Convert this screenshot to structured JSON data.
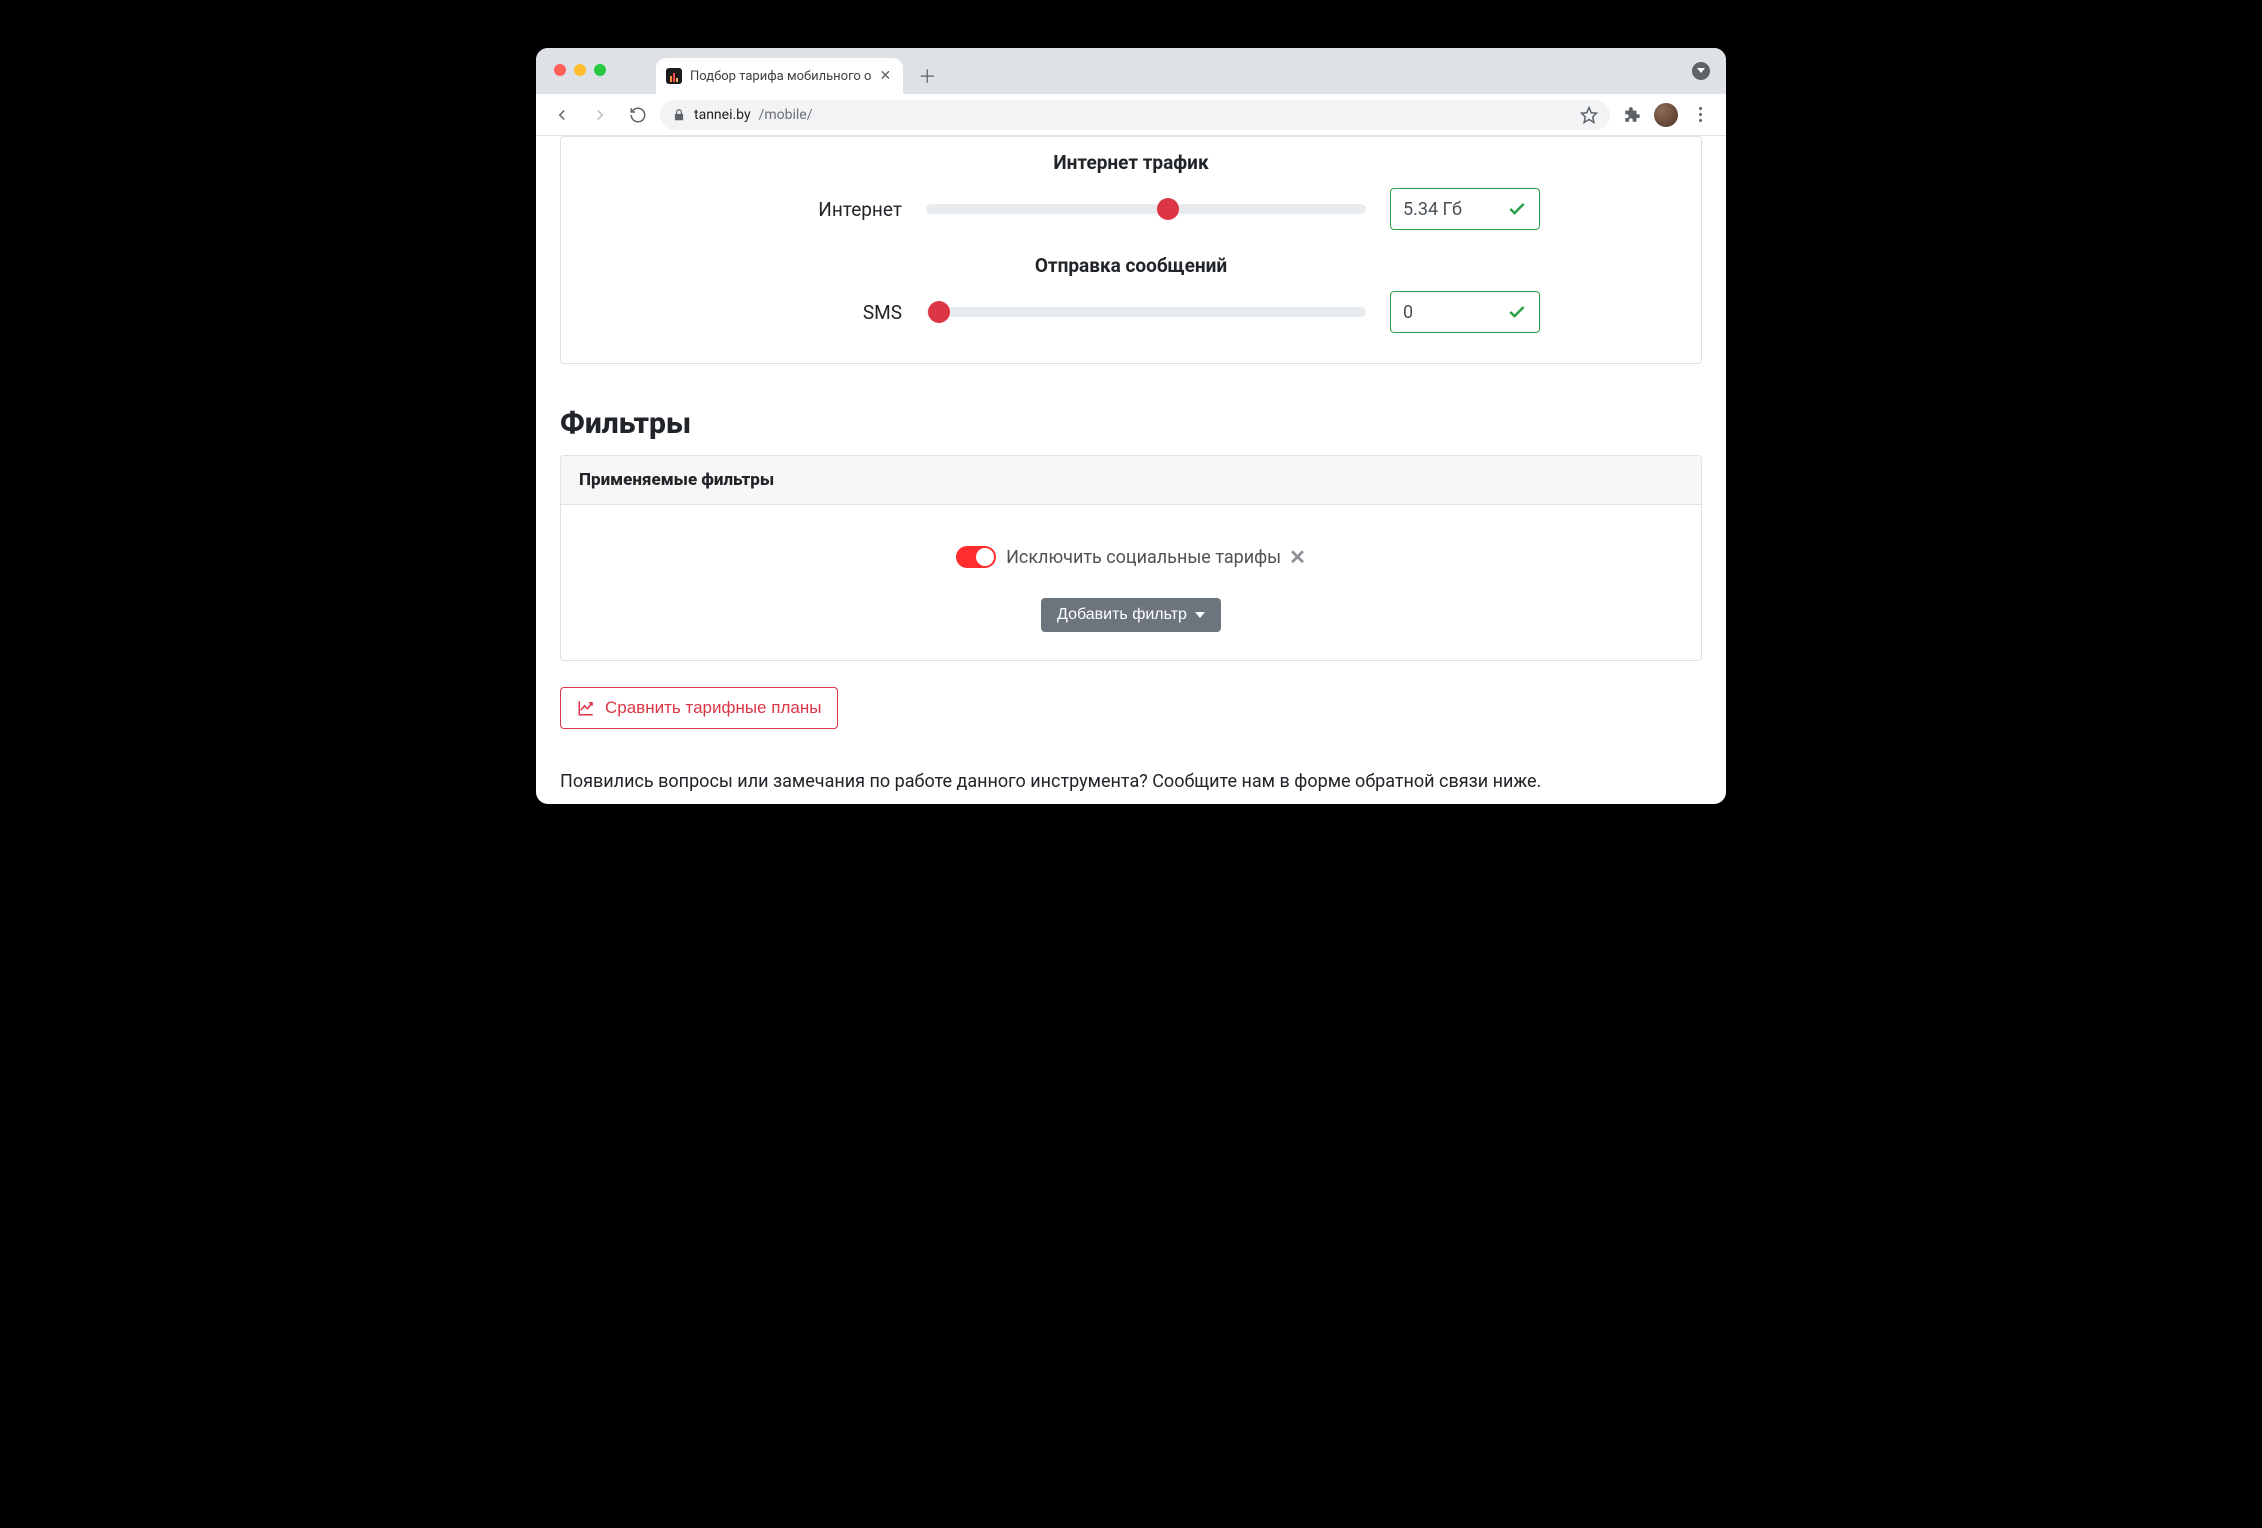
{
  "browser": {
    "tab_title": "Подбор тарифа мобильного о",
    "url_domain": "tannei.by",
    "url_path": "/mobile/"
  },
  "sliders": {
    "internet": {
      "heading": "Интернет трафик",
      "label": "Интернет",
      "value": "5.34 Гб",
      "thumb_pct": 55
    },
    "sms": {
      "heading": "Отправка сообщений",
      "label": "SMS",
      "value": "0",
      "thumb_pct": 3
    }
  },
  "filters": {
    "section_title": "Фильтры",
    "applied_heading": "Применяемые фильтры",
    "chip_label": "Исключить социальные тарифы",
    "add_button": "Добавить фильтр"
  },
  "compare_button": "Сравнить тарифные планы",
  "footer_text": "Появились вопросы или замечания по работе данного инструмента? Сообщите нам в форме обратной связи ниже."
}
